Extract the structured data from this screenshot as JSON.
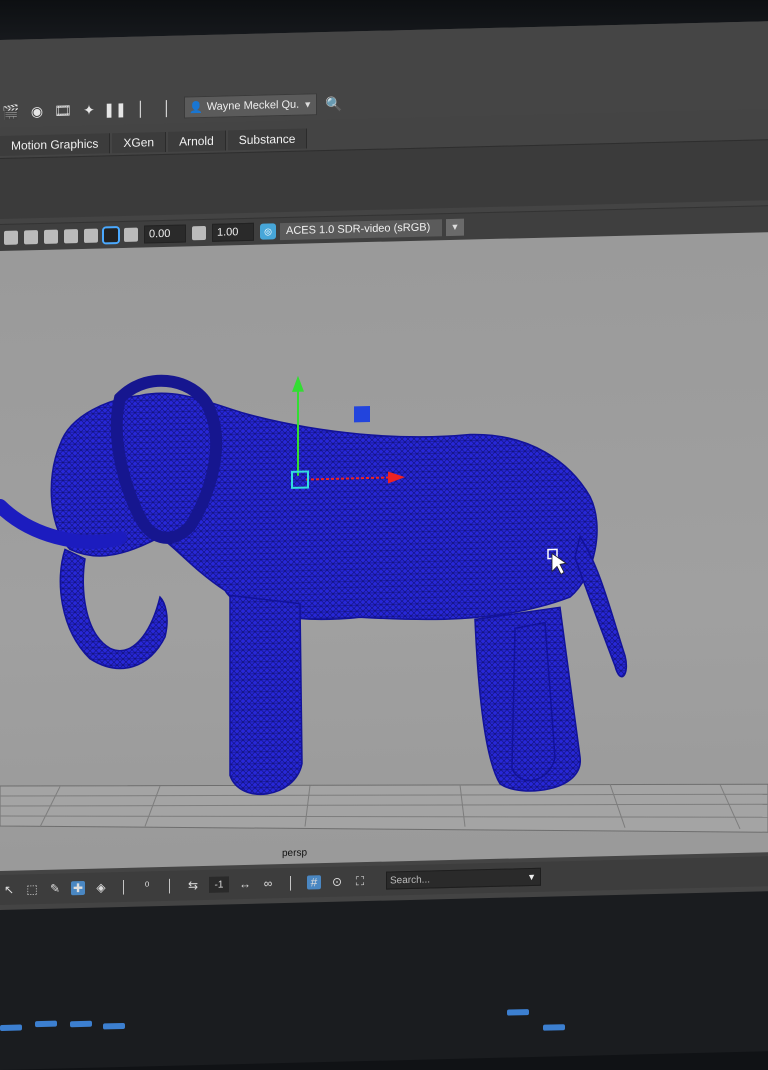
{
  "toolbar": {
    "user_label": "Wayne Meckel Qu.",
    "icons": [
      "render-icon",
      "ipr-icon",
      "render-settings-icon",
      "hypershade-icon",
      "pause-icon"
    ]
  },
  "shelf": {
    "tabs": [
      "Motion Graphics",
      "XGen",
      "Arnold",
      "Substance"
    ]
  },
  "panel_toolbar": {
    "exposure": "0.00",
    "gamma": "1.00",
    "color_space": "ACES 1.0 SDR-video (sRGB)"
  },
  "viewport": {
    "camera_label": "persp",
    "mesh_color": "#1c1ccc",
    "background_color": "#9e9e9e"
  },
  "status_bar": {
    "field_value": "-1",
    "search_placeholder": "Search..."
  }
}
